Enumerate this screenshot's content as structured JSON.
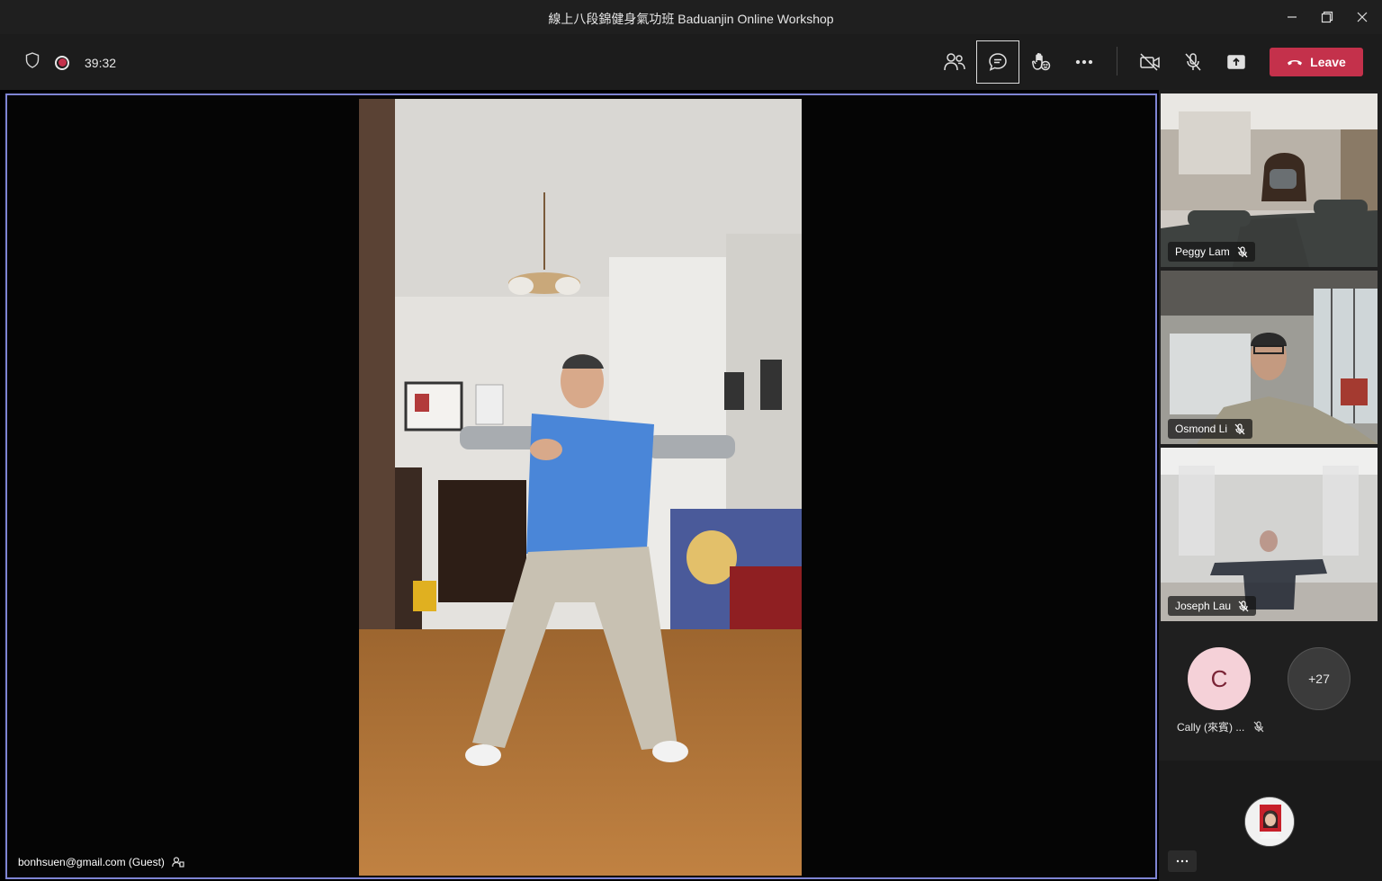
{
  "window": {
    "title": "線上八段錦健身氣功班 Baduanjin Online Workshop"
  },
  "toolbar": {
    "timer": "39:32",
    "leave_label": "Leave",
    "accent_color": "#c4314b"
  },
  "stage": {
    "guest_label": "bonhsuen@gmail.com (Guest)",
    "highlight_color": "#7f85d4"
  },
  "participants": [
    {
      "name": "Peggy Lam",
      "muted": true
    },
    {
      "name": "Osmond Li",
      "muted": true
    },
    {
      "name": "Joseph Lau",
      "muted": true
    }
  ],
  "roster": {
    "avatar_initial": "C",
    "avatar_name": "Cally (來賓) ...",
    "overflow_count": "+27"
  },
  "icons": [
    "shield-icon",
    "record-icon",
    "people-icon",
    "chat-icon",
    "raise-hand-icon",
    "more-icon",
    "camera-off-icon",
    "mic-off-icon",
    "share-icon",
    "phone-icon"
  ]
}
